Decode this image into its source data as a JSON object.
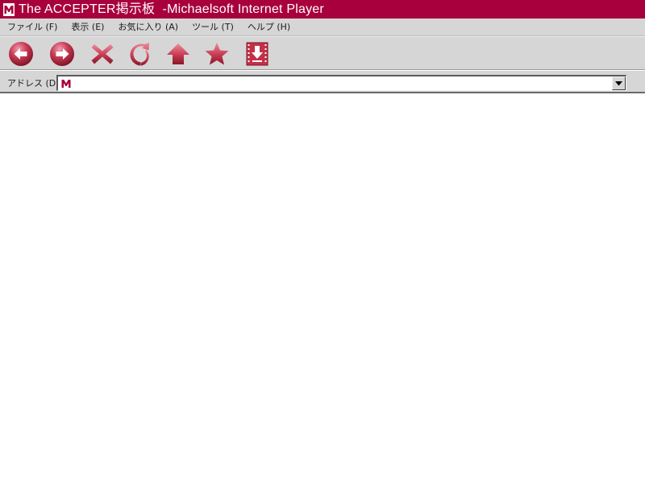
{
  "window": {
    "title": "The ACCEPTER掲示板  -Michaelsoft Internet Player",
    "accent_color": "#a8003c",
    "app_icon": "m-logo-icon"
  },
  "menubar": {
    "items": [
      {
        "label": "ファイル (F)"
      },
      {
        "label": "表示 (E)"
      },
      {
        "label": "お気に入り (A)"
      },
      {
        "label": "ツール (T)"
      },
      {
        "label": "ヘルプ (H)"
      }
    ]
  },
  "toolbar": {
    "buttons": [
      {
        "icon": "back-arrow-icon"
      },
      {
        "icon": "forward-arrow-icon"
      },
      {
        "icon": "stop-x-icon"
      },
      {
        "icon": "refresh-icon"
      },
      {
        "icon": "home-icon"
      },
      {
        "icon": "favorites-star-icon"
      },
      {
        "icon": "download-icon"
      }
    ]
  },
  "addressbar": {
    "label": "アドレス (D)",
    "value": "",
    "favicon": "m-logo-icon"
  }
}
